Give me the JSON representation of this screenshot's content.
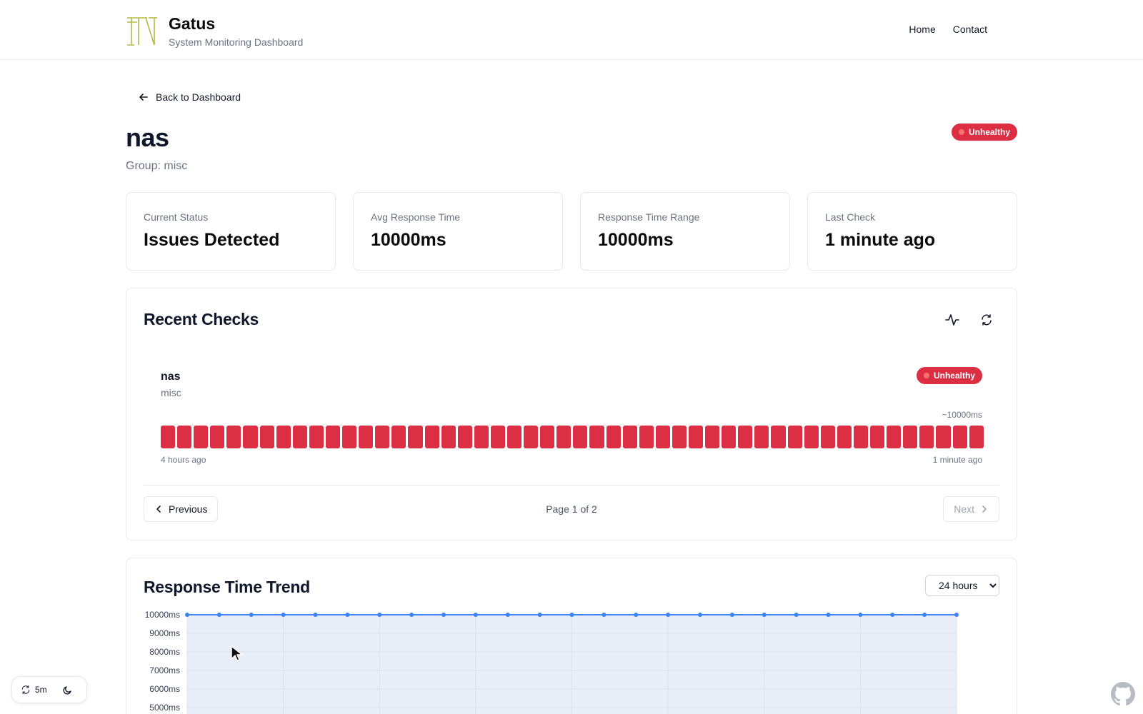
{
  "header": {
    "brand_title": "Gatus",
    "brand_subtitle": "System Monitoring Dashboard",
    "nav": [
      {
        "label": "Home"
      },
      {
        "label": "Contact"
      }
    ]
  },
  "back_link": "Back to Dashboard",
  "endpoint": {
    "name": "nas",
    "group_label": "Group: misc",
    "status_badge": "Unhealthy"
  },
  "stats": [
    {
      "label": "Current Status",
      "value": "Issues Detected"
    },
    {
      "label": "Avg Response Time",
      "value": "10000ms"
    },
    {
      "label": "Response Time Range",
      "value": "10000ms"
    },
    {
      "label": "Last Check",
      "value": "1 minute ago"
    }
  ],
  "recent_checks": {
    "title": "Recent Checks",
    "icons": [
      "activity-icon",
      "refresh-icon"
    ],
    "endpoint_name": "nas",
    "endpoint_group": "misc",
    "badge": "Unhealthy",
    "avg_label": "~10000ms",
    "result_count": 50,
    "result_status": "unhealthy",
    "oldest_label": "4 hours ago",
    "newest_label": "1 minute ago",
    "prev_label": "Previous",
    "next_label": "Next",
    "page_label": "Page 1 of 2"
  },
  "trend": {
    "title": "Response Time Trend",
    "range_selected": "24 hours"
  },
  "chart_data": {
    "type": "area",
    "title": "Response Time Trend",
    "y_tick_labels": [
      "10000ms",
      "9000ms",
      "8000ms",
      "7000ms",
      "6000ms",
      "5000ms"
    ],
    "ylim": [
      5000,
      10000
    ],
    "x": [
      1,
      2,
      3,
      4,
      5,
      6,
      7,
      8,
      9,
      10,
      11,
      12,
      13,
      14,
      15,
      16,
      17,
      18,
      19,
      20,
      21,
      22,
      23,
      24,
      25
    ],
    "series": [
      {
        "values": [
          10000,
          10000,
          10000,
          10000,
          10000,
          10000,
          10000,
          10000,
          10000,
          10000,
          10000,
          10000,
          10000,
          10000,
          10000,
          10000,
          10000,
          10000,
          10000,
          10000,
          10000,
          10000,
          10000,
          10000,
          10000
        ]
      }
    ],
    "grid": true
  },
  "bottom_widget": {
    "refresh_interval": "5m",
    "icons": [
      "refresh-icon",
      "moon-icon"
    ]
  },
  "colors": {
    "unhealthy": "#dc2f44",
    "line": "#3b82f6",
    "area_fill": "#e8eef8"
  }
}
